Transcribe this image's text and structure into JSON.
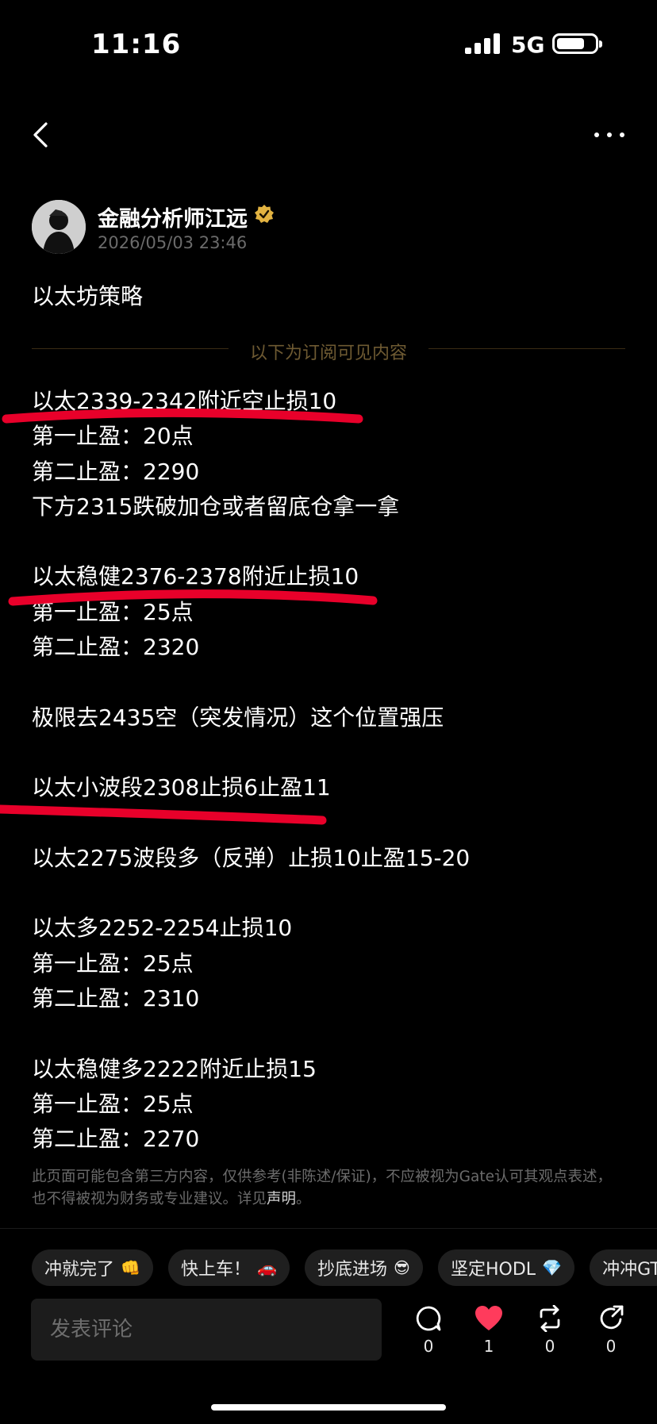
{
  "status_bar": {
    "time": "11:16",
    "network": "5G"
  },
  "post": {
    "author": "金融分析师江远",
    "date": "2026/05/03 23:46",
    "title": "以太坊策略",
    "divider_text": "以下为订阅可见内容",
    "lines": [
      "以太2339-2342附近空止损10",
      "第一止盈：20点",
      "第二止盈：2290",
      "下方2315跌破加仓或者留底仓拿一拿",
      "",
      "以太稳健2376-2378附近止损10",
      "第一止盈：25点",
      "第二止盈：2320",
      "",
      "极限去2435空（突发情况）这个位置强压",
      "",
      "以太小波段2308止损6止盈11",
      "",
      "以太2275波段多（反弹）止损10止盈15-20",
      "",
      "以太多2252-2254止损10",
      "第一止盈：25点",
      "第二止盈：2310",
      "",
      "以太稳健多2222附近止损15",
      "第一止盈：25点",
      "第二止盈：2270"
    ],
    "disclaimer_prefix": "此页面可能包含第三方内容，仅供参考(非陈述/保证)，不应被视为Gate认可其观点表述，也不得被视为财务或专业建议。详见",
    "disclaimer_link": "声明",
    "disclaimer_suffix": "。"
  },
  "chips": [
    {
      "label": "冲就完了",
      "emoji": "👊"
    },
    {
      "label": "快上车！",
      "emoji": "🚗"
    },
    {
      "label": "抄底进场",
      "emoji": "😎"
    },
    {
      "label": "坚定HODL",
      "emoji": "💎"
    },
    {
      "label": "冲冲GT",
      "emoji": ""
    }
  ],
  "bottom_bar": {
    "comment_placeholder": "发表评论",
    "comment_count": "0",
    "like_count": "1",
    "repost_count": "0",
    "share_count": "0"
  },
  "colors": {
    "like": "#ff3b5c",
    "verified": "#e3b341",
    "annotation": "#e8002a"
  }
}
